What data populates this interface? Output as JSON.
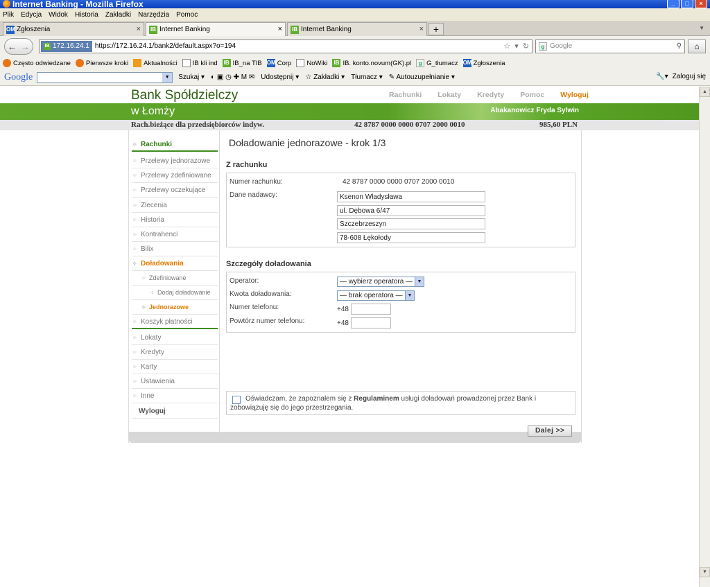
{
  "window": {
    "title": "Internet Banking - Mozilla Firefox",
    "controls": [
      "_",
      "□",
      "×"
    ]
  },
  "menu": [
    "Plik",
    "Edycja",
    "Widok",
    "Historia",
    "Zakładki",
    "Narzędzia",
    "Pomoc"
  ],
  "tabs": [
    {
      "label": "Zgłoszenia",
      "icon": "OM",
      "active": false
    },
    {
      "label": "Internet Banking",
      "icon": "IB",
      "active": true
    },
    {
      "label": "Internet Banking",
      "icon": "IB",
      "active": false
    }
  ],
  "nav": {
    "back": "←",
    "forward": "→",
    "site_badge": "172.16.24.1",
    "url": "https://172.16.24.1/bank2/default.aspx?o=194",
    "search_placeholder": "Google",
    "home": "⌂"
  },
  "bookmarks": [
    {
      "label": "Często odwiedzane",
      "icon": "ff"
    },
    {
      "label": "Pierwsze kroki",
      "icon": "ff"
    },
    {
      "label": "Aktualności",
      "icon": "rss"
    },
    {
      "label": "IB kli ind",
      "icon": "doc"
    },
    {
      "label": "IB_na TIB",
      "icon": "ib"
    },
    {
      "label": "Corp",
      "icon": "om"
    },
    {
      "label": "NoWiki",
      "icon": "doc"
    },
    {
      "label": "IB. konto.novum(GK).pl",
      "icon": "ib"
    },
    {
      "label": "G_tłumacz",
      "icon": "g"
    },
    {
      "label": "Zgłoszenia",
      "icon": "om"
    }
  ],
  "googlebar": {
    "logo": "Google",
    "tools": [
      "Szukaj",
      "Udostępnij",
      "Zakładki",
      "Tłumacz",
      "Autouzupełnianie"
    ],
    "login": "Zaloguj się"
  },
  "bank": {
    "name_line1": "Bank Spółdzielczy",
    "name_line2": "w Łomży",
    "topnav": [
      "Rachunki",
      "Lokaty",
      "Kredyty",
      "Pomoc",
      "Wyloguj"
    ],
    "user": "Abakanowicz Fryda Sylwin",
    "account_type": "Rach.bieżące dla przedsiębiorców indyw.",
    "account_number": "42 8787 0000 0000 0707 2000 0010",
    "balance": "985,60 PLN"
  },
  "sidebar": [
    {
      "label": "Rachunki",
      "style": "green"
    },
    {
      "label": "Przelewy jednorazowe",
      "style": ""
    },
    {
      "label": "Przelewy zdefiniowane",
      "style": ""
    },
    {
      "label": "Przelewy oczekujące",
      "style": ""
    },
    {
      "label": "Zlecenia",
      "style": ""
    },
    {
      "label": "Historia",
      "style": ""
    },
    {
      "label": "Kontrahenci",
      "style": ""
    },
    {
      "label": "Bilix",
      "style": ""
    },
    {
      "label": "Doładowania",
      "style": "orange"
    },
    {
      "label": "Zdefiniowane",
      "style": "sub1"
    },
    {
      "label": "Dodaj doładowanie",
      "style": "sub2"
    },
    {
      "label": "Jednorazowe",
      "style": "sub1 orange"
    },
    {
      "label": "Koszyk płatności",
      "style": ""
    },
    {
      "label": "Lokaty",
      "style": ""
    },
    {
      "label": "Kredyty",
      "style": ""
    },
    {
      "label": "Karty",
      "style": ""
    },
    {
      "label": "Ustawienia",
      "style": ""
    },
    {
      "label": "Inne",
      "style": ""
    },
    {
      "label": "Wyloguj",
      "style": "nobullet"
    }
  ],
  "form": {
    "title": "Doładowanie jednorazowe - krok 1/3",
    "from_section": "Z rachunku",
    "account_label": "Numer rachunku:",
    "account_value": "42 8787 0000 0000 0707 2000 0010",
    "sender_label": "Dane nadawcy:",
    "sender_lines": [
      "Ksenon Władysława",
      "ul. Dębowa 6/47",
      "Szczebrzeszyn",
      "78-608 Łękołody"
    ],
    "details_section": "Szczegóły doładowania",
    "operator_label": "Operator:",
    "operator_value": "— wybierz operatora —",
    "amount_label": "Kwota doładowania:",
    "amount_value": "— brak operatora —",
    "phone_label": "Numer telefonu:",
    "phone_repeat_label": "Powtórz numer telefonu:",
    "phone_prefix": "+48",
    "declaration_before": "Oświadczam, że zapoznałem się z ",
    "declaration_link": "Regulaminem",
    "declaration_after": " usługi doładowań prowadzonej przez Bank i zobowiązuję się do jego przestrzegania.",
    "next_button": "Dalej >>"
  }
}
